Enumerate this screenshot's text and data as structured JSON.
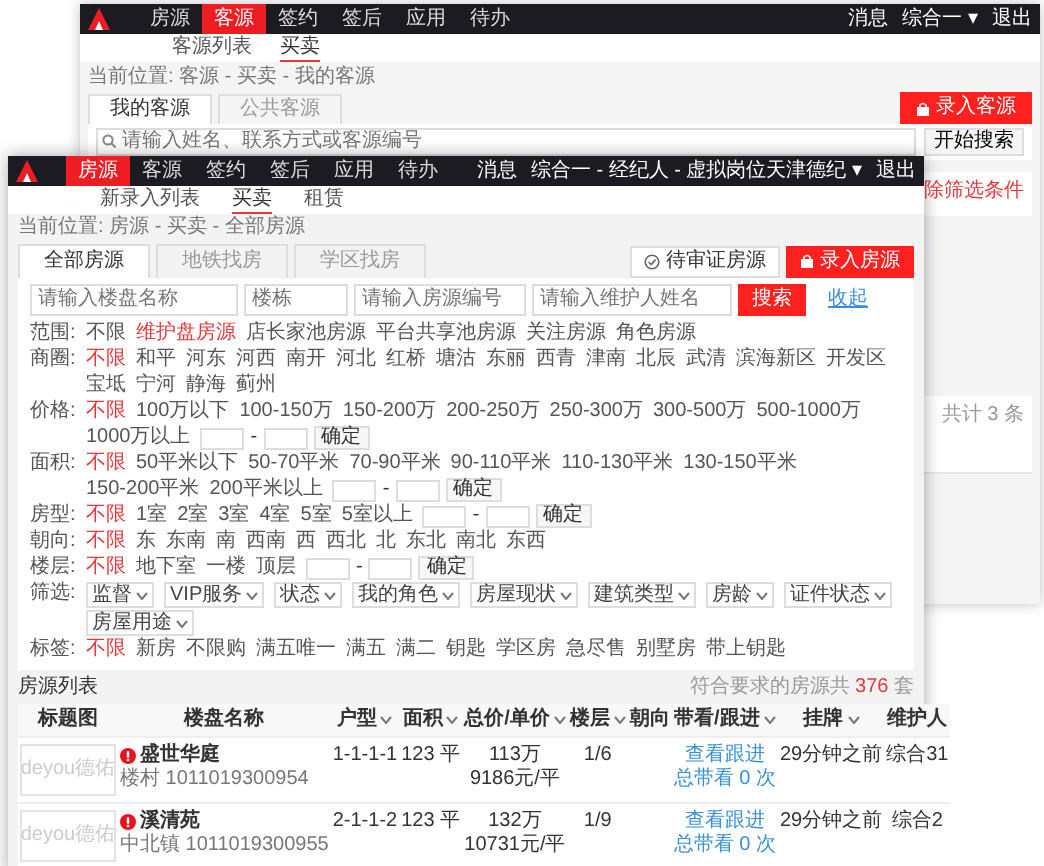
{
  "back_window": {
    "nav": {
      "items": [
        {
          "label": "房源",
          "selected": false
        },
        {
          "label": "客源",
          "selected": true
        },
        {
          "label": "签约",
          "selected": false
        },
        {
          "label": "签后",
          "selected": false
        },
        {
          "label": "应用",
          "selected": false
        },
        {
          "label": "待办",
          "selected": false
        }
      ],
      "links": [
        "消息",
        "综合一 ▾",
        "退出"
      ]
    },
    "subnav": [
      {
        "label": "客源列表",
        "selected": false
      },
      {
        "label": "买卖",
        "selected": true
      }
    ],
    "breadcrumb": "当前位置: 客源 - 买卖 - 我的客源",
    "tabs": [
      {
        "label": "我的客源",
        "selected": true
      },
      {
        "label": "公共客源",
        "selected": false
      }
    ],
    "add_button": "录入客源",
    "search": {
      "placeholder": "请输入姓名、联系方式或客源编号",
      "button": "开始搜索"
    },
    "clear_link": "除筛选条件",
    "total": "共计 3 条"
  },
  "front_window": {
    "nav": {
      "items": [
        {
          "label": "房源",
          "selected": true
        },
        {
          "label": "客源",
          "selected": false
        },
        {
          "label": "签约",
          "selected": false
        },
        {
          "label": "签后",
          "selected": false
        },
        {
          "label": "应用",
          "selected": false
        },
        {
          "label": "待办",
          "selected": false
        }
      ],
      "links": [
        "消息",
        "综合一 - 经纪人 - 虚拟岗位天津德纪 ▾",
        "退出"
      ]
    },
    "subnav": [
      {
        "label": "新录入列表",
        "selected": false
      },
      {
        "label": "买卖",
        "selected": true
      },
      {
        "label": "租赁",
        "selected": false
      }
    ],
    "breadcrumb": "当前位置: 房源 - 买卖 - 全部房源",
    "tabs": [
      {
        "label": "全部房源",
        "selected": true
      },
      {
        "label": "地铁找房",
        "selected": false
      },
      {
        "label": "学区找房",
        "selected": false
      }
    ],
    "review_button": "待审证房源",
    "add_button": "录入房源",
    "search_fields": [
      {
        "placeholder": "请输入楼盘名称"
      },
      {
        "placeholder": "楼栋"
      },
      {
        "placeholder": "请输入房源编号"
      },
      {
        "placeholder": "请输入维护人姓名"
      }
    ],
    "search_button": "搜索",
    "collapse_link": "收起",
    "filters": [
      {
        "kind": "options",
        "label": "范围:",
        "options": [
          {
            "label": "不限",
            "selected": false
          },
          {
            "label": "维护盘房源",
            "selected": true
          },
          {
            "label": "店长家池房源",
            "selected": false
          },
          {
            "label": "平台共享池房源",
            "selected": false
          },
          {
            "label": "关注房源",
            "selected": false
          },
          {
            "label": "角色房源",
            "selected": false
          }
        ]
      },
      {
        "kind": "options",
        "label": "商圈:",
        "options": [
          {
            "label": "不限",
            "selected": true
          },
          {
            "label": "和平",
            "selected": false
          },
          {
            "label": "河东",
            "selected": false
          },
          {
            "label": "河西",
            "selected": false
          },
          {
            "label": "南开",
            "selected": false
          },
          {
            "label": "河北",
            "selected": false
          },
          {
            "label": "红桥",
            "selected": false
          },
          {
            "label": "塘沽",
            "selected": false
          },
          {
            "label": "东丽",
            "selected": false
          },
          {
            "label": "西青",
            "selected": false
          },
          {
            "label": "津南",
            "selected": false
          },
          {
            "label": "北辰",
            "selected": false
          },
          {
            "label": "武清",
            "selected": false
          },
          {
            "label": "滨海新区",
            "selected": false
          },
          {
            "label": "开发区",
            "selected": false
          },
          {
            "label": "宝坻",
            "selected": false
          },
          {
            "label": "宁河",
            "selected": false
          },
          {
            "label": "静海",
            "selected": false
          },
          {
            "label": "蓟州",
            "selected": false
          }
        ]
      },
      {
        "kind": "range",
        "label": "价格:",
        "options": [
          {
            "label": "不限",
            "selected": true
          },
          {
            "label": "100万以下",
            "selected": false
          },
          {
            "label": "100-150万",
            "selected": false
          },
          {
            "label": "150-200万",
            "selected": false
          },
          {
            "label": "200-250万",
            "selected": false
          },
          {
            "label": "250-300万",
            "selected": false
          },
          {
            "label": "300-500万",
            "selected": false
          },
          {
            "label": "500-1000万",
            "selected": false
          },
          {
            "label": "1000万以上",
            "selected": false
          }
        ],
        "separator": "-",
        "confirm": "确定"
      },
      {
        "kind": "range",
        "label": "面积:",
        "options": [
          {
            "label": "不限",
            "selected": true
          },
          {
            "label": "50平米以下",
            "selected": false
          },
          {
            "label": "50-70平米",
            "selected": false
          },
          {
            "label": "70-90平米",
            "selected": false
          },
          {
            "label": "90-110平米",
            "selected": false
          },
          {
            "label": "110-130平米",
            "selected": false
          },
          {
            "label": "130-150平米",
            "selected": false
          },
          {
            "label": "150-200平米",
            "selected": false
          },
          {
            "label": "200平米以上",
            "selected": false
          }
        ],
        "separator": "-",
        "confirm": "确定"
      },
      {
        "kind": "range",
        "label": "房型:",
        "options": [
          {
            "label": "不限",
            "selected": true
          },
          {
            "label": "1室",
            "selected": false
          },
          {
            "label": "2室",
            "selected": false
          },
          {
            "label": "3室",
            "selected": false
          },
          {
            "label": "4室",
            "selected": false
          },
          {
            "label": "5室",
            "selected": false
          },
          {
            "label": "5室以上",
            "selected": false
          }
        ],
        "separator": "-",
        "confirm": "确定"
      },
      {
        "kind": "options",
        "label": "朝向:",
        "options": [
          {
            "label": "不限",
            "selected": true
          },
          {
            "label": "东",
            "selected": false
          },
          {
            "label": "东南",
            "selected": false
          },
          {
            "label": "南",
            "selected": false
          },
          {
            "label": "西南",
            "selected": false
          },
          {
            "label": "西",
            "selected": false
          },
          {
            "label": "西北",
            "selected": false
          },
          {
            "label": "北",
            "selected": false
          },
          {
            "label": "东北",
            "selected": false
          },
          {
            "label": "南北",
            "selected": false
          },
          {
            "label": "东西",
            "selected": false
          }
        ]
      },
      {
        "kind": "range",
        "label": "楼层:",
        "options": [
          {
            "label": "不限",
            "selected": true
          },
          {
            "label": "地下室",
            "selected": false
          },
          {
            "label": "一楼",
            "selected": false
          },
          {
            "label": "顶层",
            "selected": false
          }
        ],
        "separator": "-",
        "confirm": "确定"
      },
      {
        "kind": "dropdowns",
        "label": "筛选:",
        "dropdowns": [
          "监督",
          "VIP服务",
          "状态",
          "我的角色",
          "房屋现状",
          "建筑类型",
          "房龄",
          "证件状态",
          "房屋用途"
        ]
      },
      {
        "kind": "options",
        "label": "标签:",
        "options": [
          {
            "label": "不限",
            "selected": true
          },
          {
            "label": "新房",
            "selected": false
          },
          {
            "label": "不限购",
            "selected": false
          },
          {
            "label": "满五唯一",
            "selected": false
          },
          {
            "label": "满五",
            "selected": false
          },
          {
            "label": "满二",
            "selected": false
          },
          {
            "label": "钥匙",
            "selected": false
          },
          {
            "label": "学区房",
            "selected": false
          },
          {
            "label": "急尽售",
            "selected": false
          },
          {
            "label": "别墅房",
            "selected": false
          },
          {
            "label": "带上钥匙",
            "selected": false
          }
        ]
      }
    ],
    "list_title": "房源列表",
    "total": {
      "prefix": "符合要求的房源共",
      "count": "376",
      "suffix": "套"
    },
    "table": {
      "columns": [
        {
          "label": "标题图",
          "sortable": false
        },
        {
          "label": "楼盘名称",
          "sortable": false
        },
        {
          "label": "户型",
          "sortable": true
        },
        {
          "label": "面积",
          "sortable": true
        },
        {
          "label": "总价/单价",
          "sortable": true
        },
        {
          "label": "楼层",
          "sortable": true
        },
        {
          "label": "朝向",
          "sortable": false
        },
        {
          "label": "带看/跟进",
          "sortable": true
        },
        {
          "label": "挂牌",
          "sortable": true
        },
        {
          "label": "维护人",
          "sortable": false
        }
      ],
      "rows": [
        {
          "thumb_text": "deyou德佑",
          "name": "盛世华庭",
          "code": "楼村 1011019300954",
          "layout": "1-1-1-1",
          "area": "123 平",
          "total_price": "113万",
          "unit_price": "9186元/平",
          "floor": "1/6",
          "follow_link": "查看跟进",
          "viewings": "总带看 0 次",
          "listed": "29分钟之前",
          "agent": "综合31"
        },
        {
          "thumb_text": "deyou德佑",
          "name": "溪清苑",
          "code": "中北镇 1011019300955",
          "layout": "2-1-1-2",
          "area": "123 平",
          "total_price": "132万",
          "unit_price": "10731元/平",
          "floor": "1/9",
          "follow_link": "查看跟进",
          "viewings": "总带看 0 次",
          "listed": "29分钟之前",
          "agent": "综合2"
        }
      ]
    }
  }
}
